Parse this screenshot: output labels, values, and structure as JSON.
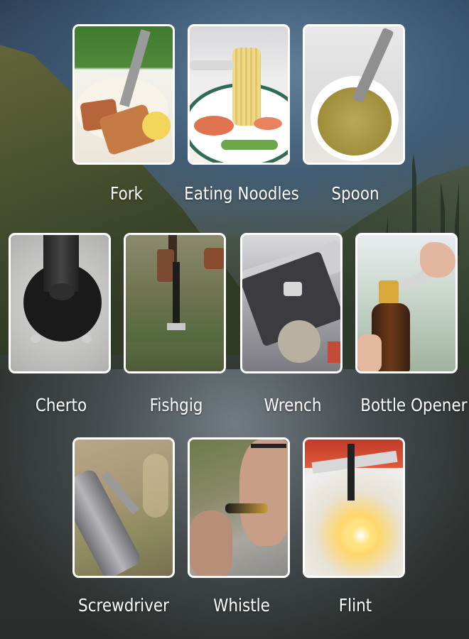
{
  "items": [
    {
      "label": "Fork"
    },
    {
      "label": "Eating Noodles"
    },
    {
      "label": "Spoon"
    },
    {
      "label": "Cherto"
    },
    {
      "label": "Fishgig"
    },
    {
      "label": "Wrench"
    },
    {
      "label": "Bottle Opener"
    },
    {
      "label": "Screwdriver"
    },
    {
      "label": "Whistle"
    },
    {
      "label": "Flint"
    }
  ],
  "colors": {
    "tile_border": "#ffffff",
    "label_text": "#ffffff"
  }
}
